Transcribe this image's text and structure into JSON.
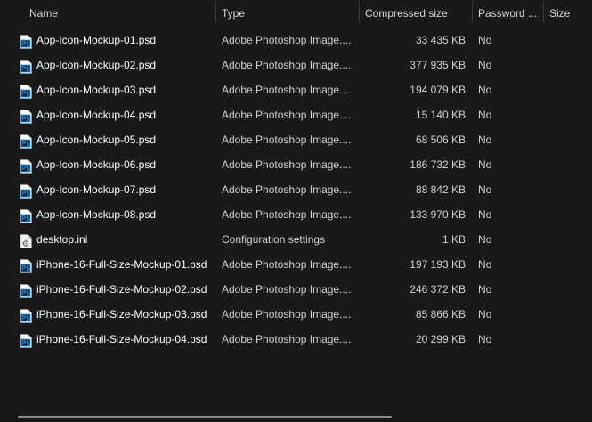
{
  "columns": {
    "name": "Name",
    "type": "Type",
    "compressed_size": "Compressed size",
    "password": "Password ...",
    "size": "Size"
  },
  "sort": {
    "column": "name",
    "direction": "ascending",
    "indicator": "^"
  },
  "files": [
    {
      "name": "App-Icon-Mockup-01.psd",
      "icon": "photoshop-file-icon",
      "type": "Adobe Photoshop Image....",
      "compressed_size": "33 435 KB",
      "password": "No",
      "size": ""
    },
    {
      "name": "App-Icon-Mockup-02.psd",
      "icon": "photoshop-file-icon",
      "type": "Adobe Photoshop Image....",
      "compressed_size": "377 935 KB",
      "password": "No",
      "size": ""
    },
    {
      "name": "App-Icon-Mockup-03.psd",
      "icon": "photoshop-file-icon",
      "type": "Adobe Photoshop Image....",
      "compressed_size": "194 079 KB",
      "password": "No",
      "size": ""
    },
    {
      "name": "App-Icon-Mockup-04.psd",
      "icon": "photoshop-file-icon",
      "type": "Adobe Photoshop Image....",
      "compressed_size": "15 140 KB",
      "password": "No",
      "size": ""
    },
    {
      "name": "App-Icon-Mockup-05.psd",
      "icon": "photoshop-file-icon",
      "type": "Adobe Photoshop Image....",
      "compressed_size": "68 506 KB",
      "password": "No",
      "size": ""
    },
    {
      "name": "App-Icon-Mockup-06.psd",
      "icon": "photoshop-file-icon",
      "type": "Adobe Photoshop Image....",
      "compressed_size": "186 732 KB",
      "password": "No",
      "size": ""
    },
    {
      "name": "App-Icon-Mockup-07.psd",
      "icon": "photoshop-file-icon",
      "type": "Adobe Photoshop Image....",
      "compressed_size": "88 842 KB",
      "password": "No",
      "size": ""
    },
    {
      "name": "App-Icon-Mockup-08.psd",
      "icon": "photoshop-file-icon",
      "type": "Adobe Photoshop Image....",
      "compressed_size": "133 970 KB",
      "password": "No",
      "size": ""
    },
    {
      "name": "desktop.ini",
      "icon": "settings-file-icon",
      "type": "Configuration settings",
      "compressed_size": "1 KB",
      "password": "No",
      "size": ""
    },
    {
      "name": "iPhone-16-Full-Size-Mockup-01.psd",
      "icon": "photoshop-file-icon",
      "type": "Adobe Photoshop Image....",
      "compressed_size": "197 193 KB",
      "password": "No",
      "size": ""
    },
    {
      "name": "iPhone-16-Full-Size-Mockup-02.psd",
      "icon": "photoshop-file-icon",
      "type": "Adobe Photoshop Image....",
      "compressed_size": "246 372 KB",
      "password": "No",
      "size": ""
    },
    {
      "name": "iPhone-16-Full-Size-Mockup-03.psd",
      "icon": "photoshop-file-icon",
      "type": "Adobe Photoshop Image....",
      "compressed_size": "85 866 KB",
      "password": "No",
      "size": ""
    },
    {
      "name": "iPhone-16-Full-Size-Mockup-04.psd",
      "icon": "photoshop-file-icon",
      "type": "Adobe Photoshop Image....",
      "compressed_size": "20 299 KB",
      "password": "No",
      "size": ""
    }
  ],
  "colors": {
    "background": "#191919",
    "text": "#ffffff",
    "secondary_text": "#d0d0d0",
    "psd_icon_blue": "#31a8ff",
    "psd_icon_bg": "#001e36"
  }
}
